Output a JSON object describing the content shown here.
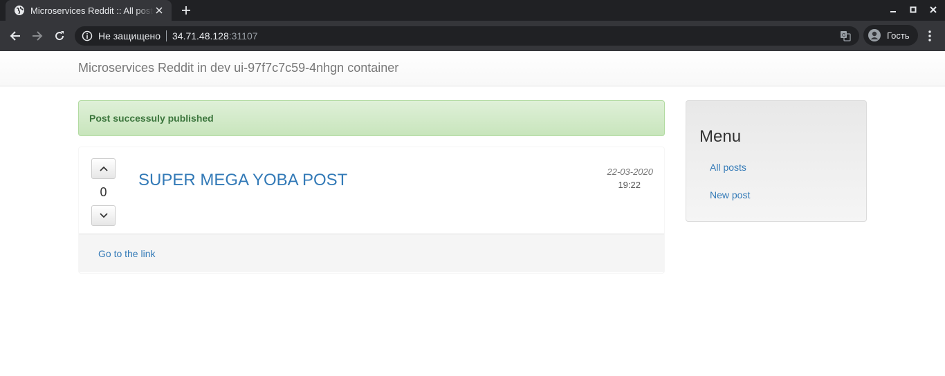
{
  "browser": {
    "tab_title": "Microservices Reddit :: All posts",
    "omnibox": {
      "security_label": "Не защищено",
      "host": "34.71.48.128",
      "port": ":31107"
    },
    "profile_label": "Гость",
    "icons": [
      "globe-icon",
      "close-icon",
      "plus-icon",
      "minimize-icon",
      "maximize-icon",
      "window-close-icon",
      "back-icon",
      "forward-icon",
      "reload-icon",
      "info-icon",
      "translate-icon",
      "avatar-icon",
      "more-icon"
    ]
  },
  "page": {
    "brand": "Microservices Reddit in dev ui-97f7c7c59-4nhgn container",
    "alert": "Post successuly published",
    "post": {
      "votes": "0",
      "title": "SUPER MEGA YOBA POST",
      "date": "22-03-2020",
      "time": "19:22",
      "link_label": "Go to the link"
    },
    "sidebar": {
      "title": "Menu",
      "items": [
        {
          "label": "All posts"
        },
        {
          "label": "New post"
        }
      ]
    }
  },
  "colors": {
    "chrome_dark": "#202124",
    "chrome_toolbar": "#35363a",
    "link": "#337ab7",
    "alert_text": "#3c763d",
    "alert_bg": "#dff0d8"
  }
}
